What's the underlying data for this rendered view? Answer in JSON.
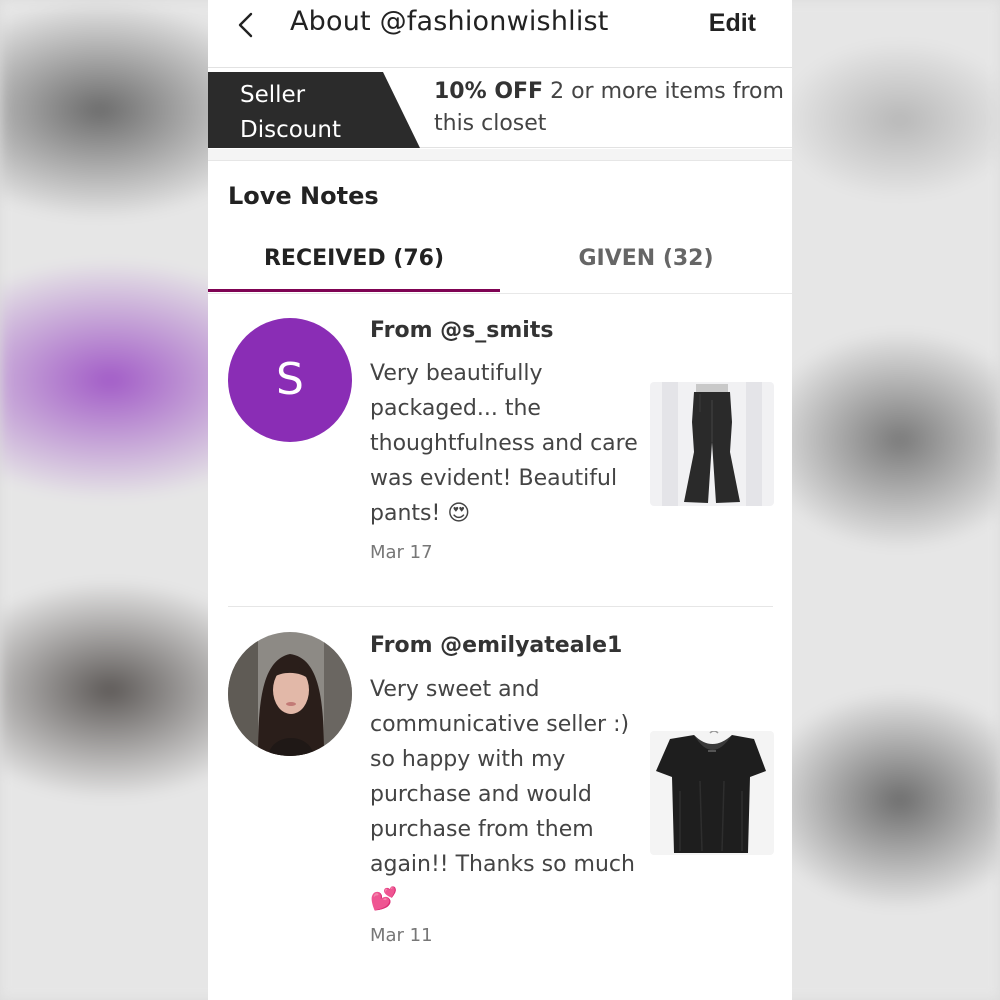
{
  "header": {
    "title": "About @fashionwishlist",
    "edit_label": "Edit"
  },
  "discount": {
    "label_line1": "Seller",
    "label_line2": "Discount",
    "offer_bold": "10% OFF",
    "offer_text": "2 or more items from this closet"
  },
  "love_notes": {
    "title": "Love Notes",
    "tabs": [
      {
        "label": "RECEIVED (76)",
        "active": true
      },
      {
        "label": "GIVEN (32)",
        "active": false
      }
    ],
    "notes": [
      {
        "from": "From @s_smits",
        "avatar_letter": "S",
        "avatar_color": "#8a2db5",
        "message": "Very beautifully packaged... the thoughtfulness and care was evident! Beautiful pants!",
        "emoji": "😍",
        "date": "Mar 17",
        "item_icon": "black-flared-pants-photo"
      },
      {
        "from": "From @emilyateale1",
        "message": "Very sweet and communicative seller :) so happy with my purchase and would purchase from them again!! Thanks so much",
        "emoji": "💕",
        "date": "Mar 11",
        "item_icon": "black-velvet-top-photo"
      }
    ]
  },
  "colors": {
    "accent": "#7f0353",
    "banner_dark": "#2b2b2b"
  }
}
